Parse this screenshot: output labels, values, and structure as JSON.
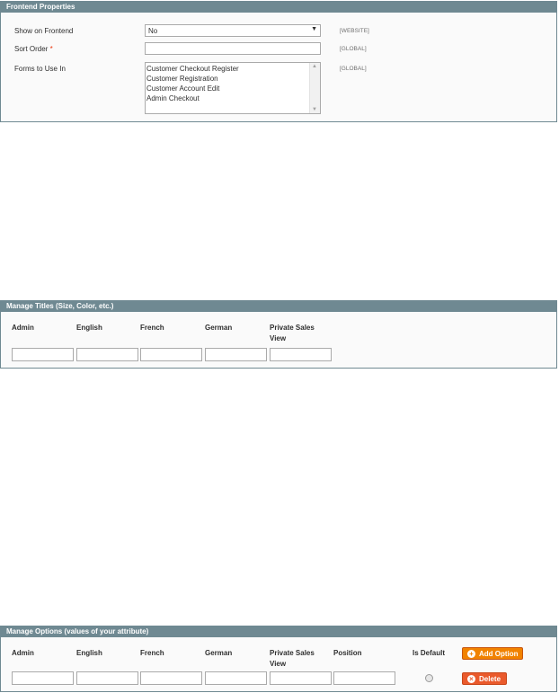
{
  "frontend_properties": {
    "title": "Frontend Properties",
    "show_on_frontend": {
      "label": "Show on Frontend",
      "value": "No",
      "scope": "[WEBSITE]"
    },
    "sort_order": {
      "label": "Sort Order",
      "required_mark": "*",
      "value": "",
      "scope": "[GLOBAL]"
    },
    "forms_to_use_in": {
      "label": "Forms to Use In",
      "scope": "[GLOBAL]",
      "options": [
        "Customer Checkout Register",
        "Customer Registration",
        "Customer Account Edit",
        "Admin Checkout"
      ]
    }
  },
  "manage_titles": {
    "title": "Manage Titles (Size, Color, etc.)",
    "columns": [
      "Admin",
      "English",
      "French",
      "German",
      "Private Sales View"
    ]
  },
  "manage_options": {
    "title": "Manage Options (values of your attribute)",
    "columns": [
      "Admin",
      "English",
      "French",
      "German",
      "Private Sales View",
      "Position",
      "Is Default"
    ],
    "add_option_label": "Add Option",
    "delete_label": "Delete"
  },
  "colors": {
    "header_bg": "#6f8992",
    "accent_orange": "#f18200",
    "required_red": "#eb340a"
  }
}
